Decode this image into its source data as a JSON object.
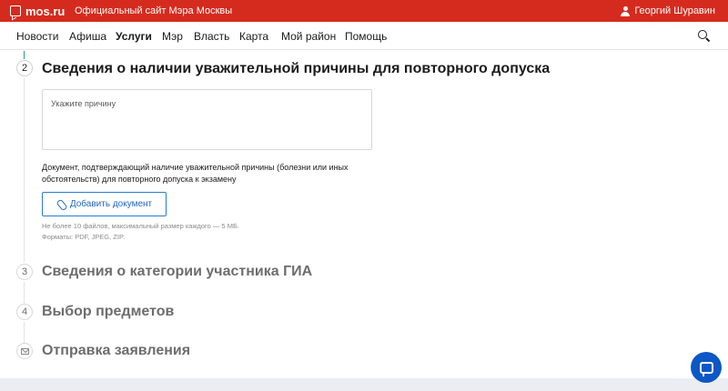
{
  "topbar": {
    "logo_text": "mos.ru",
    "site_title": "Официальный сайт Мэра Москвы",
    "user_name": "Георгий Шуравин"
  },
  "nav": {
    "items": [
      {
        "label": "Новости"
      },
      {
        "label": "Афиша"
      },
      {
        "label": "Услуги"
      },
      {
        "label": "Мэр"
      },
      {
        "label": "Власть"
      },
      {
        "label": "Карта"
      },
      {
        "label": "Мой район"
      },
      {
        "label": "Помощь"
      }
    ],
    "active_item": "Услуги",
    "search_icon": "search-icon"
  },
  "steps": [
    {
      "number": "2",
      "title": "Сведения о наличии уважительной причины для повторного допуска"
    },
    {
      "number": "3",
      "title": "Сведения о категории участника ГИА"
    },
    {
      "number": "4",
      "title": "Выбор предметов"
    },
    {
      "number": "",
      "icon": "envelope-icon",
      "title": "Отправка заявления"
    }
  ],
  "form": {
    "reason_placeholder": "Укажите причину",
    "document_note": "Документ, подтверждающий наличие уважительной причины (болезни или иных обстоятельств) для повторного допуска к экзамену",
    "add_document_label": "Добавить документ",
    "limit_line1": "Не более 10 файлов, максимальный размер каждого — 5 МБ.",
    "limit_line2": "Форматы: PDF, JPEG, ZIP."
  },
  "chat": {
    "icon": "chat-icon"
  }
}
